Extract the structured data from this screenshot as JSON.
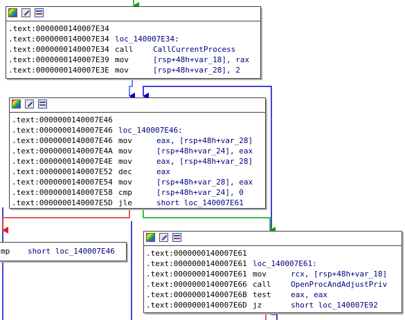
{
  "colors": {
    "edge_true": "#00a000",
    "edge_false": "#e02020",
    "edge_jump": "#0000e0",
    "operand": "#000080"
  },
  "icons": [
    "color-palette-icon",
    "edit-pencil-icon",
    "graph-overview-icon"
  ],
  "blocks": [
    {
      "lines": [
        {
          "addr": ".text:0000000140007E34",
          "label": "",
          "mnemonic": "",
          "operands": ""
        },
        {
          "addr": ".text:0000000140007E34",
          "label": "loc_140007E34:",
          "mnemonic": "",
          "operands": ""
        },
        {
          "addr": ".text:0000000140007E34",
          "label": "",
          "mnemonic": "call",
          "operands": "CallCurrentProcess"
        },
        {
          "addr": ".text:0000000140007E39",
          "label": "",
          "mnemonic": "mov",
          "operands": "[rsp+48h+var_18], rax"
        },
        {
          "addr": ".text:0000000140007E3E",
          "label": "",
          "mnemonic": "mov",
          "operands": "[rsp+48h+var_28], 2"
        }
      ]
    },
    {
      "lines": [
        {
          "addr": ".text:0000000140007E46",
          "label": "",
          "mnemonic": "",
          "operands": ""
        },
        {
          "addr": ".text:0000000140007E46",
          "label": "loc_140007E46:",
          "mnemonic": "",
          "operands": ""
        },
        {
          "addr": ".text:0000000140007E46",
          "label": "",
          "mnemonic": "mov",
          "operands": "eax, [rsp+48h+var_28]"
        },
        {
          "addr": ".text:0000000140007E4A",
          "label": "",
          "mnemonic": "mov",
          "operands": "[rsp+48h+var_24], eax"
        },
        {
          "addr": ".text:0000000140007E4E",
          "label": "",
          "mnemonic": "mov",
          "operands": "eax, [rsp+48h+var_28]"
        },
        {
          "addr": ".text:0000000140007E52",
          "label": "",
          "mnemonic": "dec",
          "operands": "eax"
        },
        {
          "addr": ".text:0000000140007E54",
          "label": "",
          "mnemonic": "mov",
          "operands": "[rsp+48h+var_28], eax"
        },
        {
          "addr": ".text:0000000140007E58",
          "label": "",
          "mnemonic": "cmp",
          "operands": "[rsp+48h+var_24], 0"
        },
        {
          "addr": ".text:0000000140007E5D",
          "label": "",
          "mnemonic": "jle",
          "operands": "short loc_140007E61"
        }
      ]
    },
    {
      "lines": [
        {
          "addr": "",
          "label": "",
          "mnemonic": "mp",
          "operands": "short loc_140007E46"
        }
      ]
    },
    {
      "lines": [
        {
          "addr": ".text:0000000140007E61",
          "label": "",
          "mnemonic": "",
          "operands": ""
        },
        {
          "addr": ".text:0000000140007E61",
          "label": "loc_140007E61:",
          "mnemonic": "",
          "operands": ""
        },
        {
          "addr": ".text:0000000140007E61",
          "label": "",
          "mnemonic": "mov",
          "operands": "rcx, [rsp+48h+var_18]"
        },
        {
          "addr": ".text:0000000140007E66",
          "label": "",
          "mnemonic": "call",
          "operands": "OpenProcAndAdjustPriv"
        },
        {
          "addr": ".text:0000000140007E6B",
          "label": "",
          "mnemonic": "test",
          "operands": "eax, eax"
        },
        {
          "addr": ".text:0000000140007E6D",
          "label": "",
          "mnemonic": "jz",
          "operands": "short loc_140007E92"
        }
      ]
    }
  ]
}
